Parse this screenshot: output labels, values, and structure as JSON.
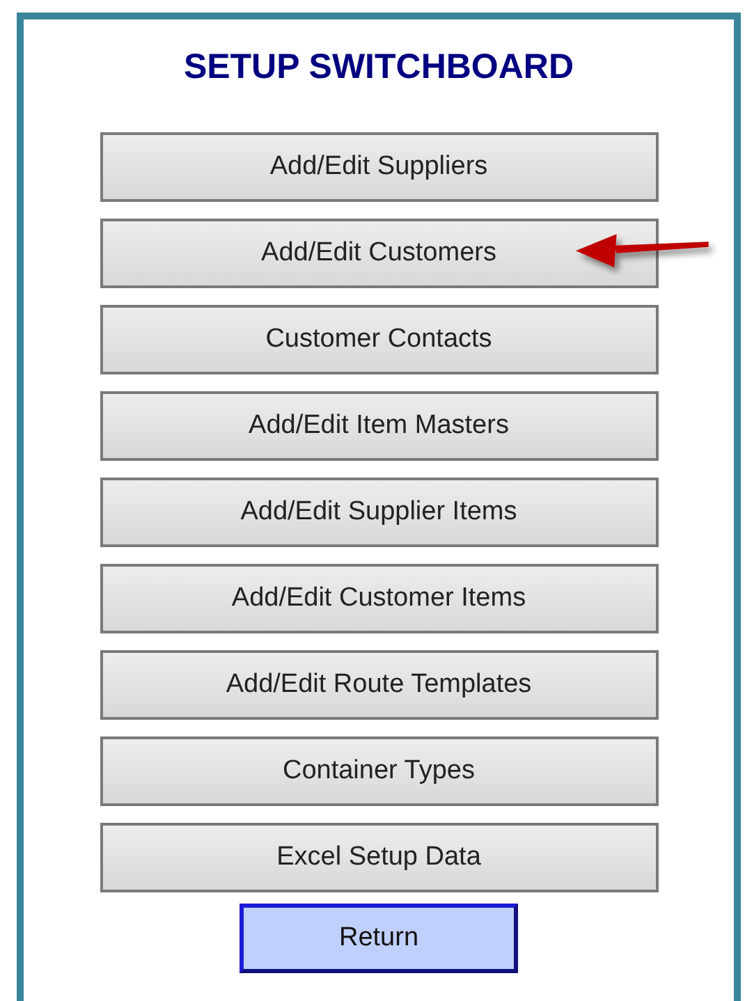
{
  "title": "SETUP SWITCHBOARD",
  "buttons": [
    {
      "label": "Add/Edit Suppliers",
      "pointed": false
    },
    {
      "label": "Add/Edit Customers",
      "pointed": true
    },
    {
      "label": "Customer Contacts",
      "pointed": false
    },
    {
      "label": "Add/Edit Item Masters",
      "pointed": false
    },
    {
      "label": "Add/Edit Supplier Items",
      "pointed": false
    },
    {
      "label": "Add/Edit Customer Items",
      "pointed": false
    },
    {
      "label": "Add/Edit Route Templates",
      "pointed": false
    },
    {
      "label": "Container Types",
      "pointed": false
    },
    {
      "label": "Excel Setup Data",
      "pointed": false
    }
  ],
  "return_button": {
    "label": "Return"
  }
}
